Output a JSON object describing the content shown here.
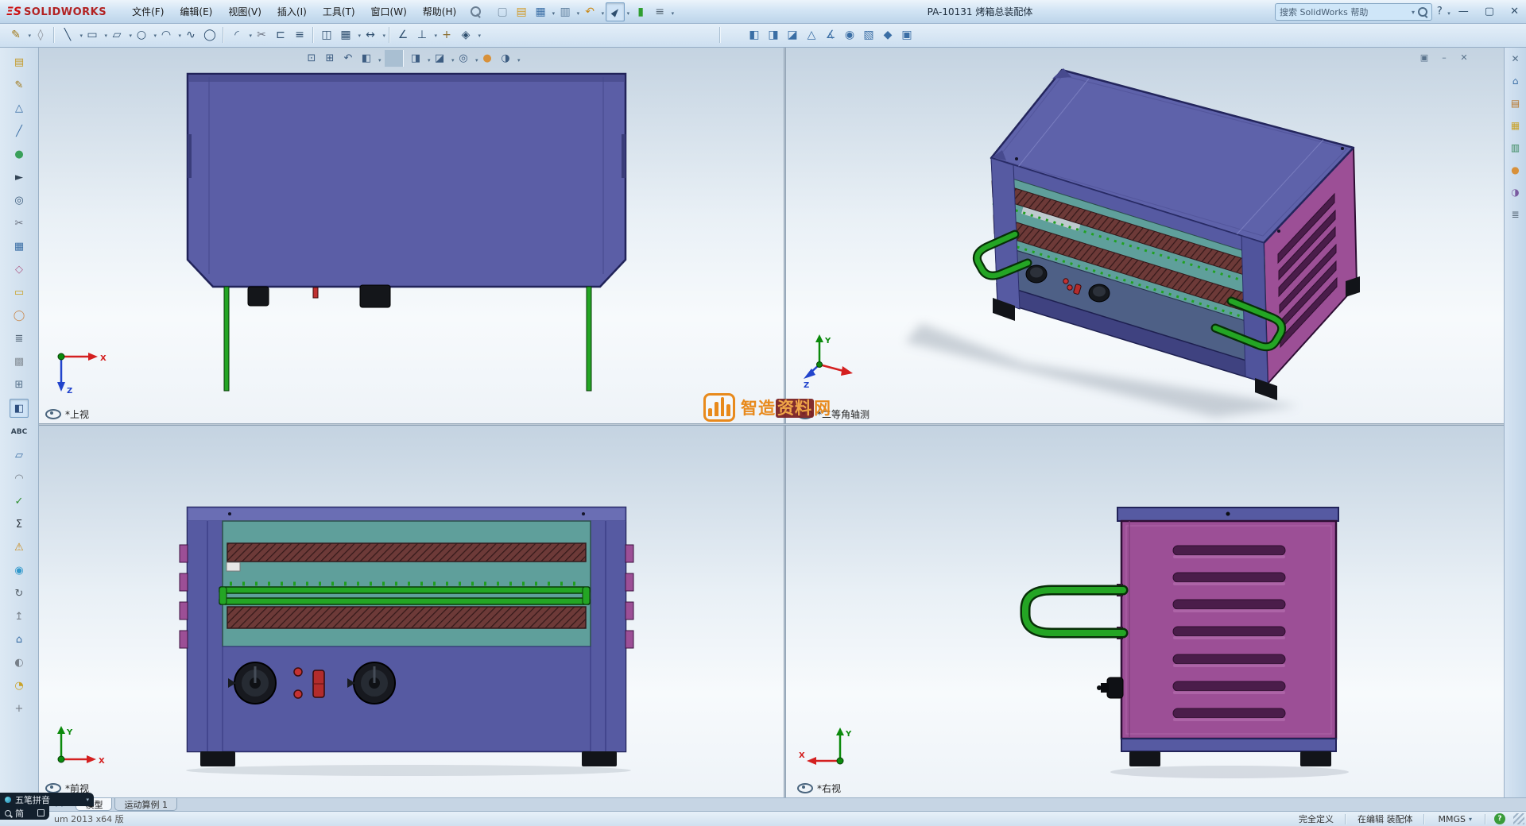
{
  "window": {
    "title": "PA-10131 烤箱总装配体"
  },
  "brand": {
    "logo_mark": "ΞS",
    "logo_text": "SOLIDWORKS"
  },
  "menubar": {
    "items": [
      {
        "name": "menu-file",
        "label": "文件(F)"
      },
      {
        "name": "menu-edit",
        "label": "编辑(E)"
      },
      {
        "name": "menu-view",
        "label": "视图(V)"
      },
      {
        "name": "menu-insert",
        "label": "插入(I)"
      },
      {
        "name": "menu-tools",
        "label": "工具(T)"
      },
      {
        "name": "menu-window",
        "label": "窗口(W)"
      },
      {
        "name": "menu-help",
        "label": "帮助(H)"
      }
    ]
  },
  "quickbar": {
    "icons": [
      {
        "name": "new-file-icon",
        "glyph": "▢",
        "color": "#8096aa"
      },
      {
        "name": "open-file-icon",
        "glyph": "▤",
        "color": "#d09a28"
      },
      {
        "name": "save-icon",
        "glyph": "▦",
        "color": "#3a6ea5",
        "dd": true
      },
      {
        "name": "print-icon",
        "glyph": "▥",
        "color": "#5b7b9a",
        "dd": true
      },
      {
        "name": "undo-icon",
        "glyph": "↶",
        "color": "#c98a1b",
        "dd": true
      },
      {
        "name": "select-icon",
        "glyph": "►",
        "color": "#2f4f6f",
        "dd": true,
        "active": true
      },
      {
        "name": "rebuild-icon",
        "glyph": "▮",
        "color": "#2f9e2f"
      },
      {
        "name": "options-icon",
        "glyph": "≡",
        "color": "#5b6b7a",
        "dd": true
      }
    ]
  },
  "search": {
    "placeholder": "搜索 SolidWorks 帮助"
  },
  "titlebar_controls": [
    {
      "name": "help-button",
      "glyph": "?",
      "dd": true
    },
    {
      "name": "minimize-button",
      "glyph": "—"
    },
    {
      "name": "maximize-button",
      "glyph": "▢"
    },
    {
      "name": "close-button",
      "glyph": "✕"
    }
  ],
  "toolbar": {
    "icons": [
      {
        "name": "sketch-icon",
        "glyph": "✎",
        "color": "#a07818",
        "dd": true
      },
      {
        "name": "eraser-icon",
        "glyph": "◊",
        "color": "#8a8f98"
      },
      {
        "sep": true
      },
      {
        "name": "line-icon",
        "glyph": "╲",
        "color": "#2f4f6f",
        "dd": true
      },
      {
        "name": "rectangle-icon",
        "glyph": "▭",
        "color": "#2f4f6f",
        "dd": true
      },
      {
        "name": "slot-icon",
        "glyph": "▱",
        "color": "#2f4f6f",
        "dd": true
      },
      {
        "name": "circle-icon",
        "glyph": "○",
        "color": "#2f4f6f",
        "dd": true
      },
      {
        "name": "arc-icon",
        "glyph": "◠",
        "color": "#2f4f6f",
        "dd": true
      },
      {
        "name": "spline-icon",
        "glyph": "∿",
        "color": "#2f4f6f"
      },
      {
        "name": "ellipse-icon",
        "glyph": "◯",
        "color": "#2f4f6f"
      },
      {
        "sep": true
      },
      {
        "name": "fillet-icon",
        "glyph": "◜",
        "color": "#2f4f6f",
        "dd": true
      },
      {
        "name": "trim-icon",
        "glyph": "✂",
        "color": "#6b7280"
      },
      {
        "name": "convert-entities-icon",
        "glyph": "⊏",
        "color": "#2f4f6f"
      },
      {
        "name": "offset-entities-icon",
        "glyph": "≡",
        "color": "#2f4f6f"
      },
      {
        "sep": true
      },
      {
        "name": "mirror-icon",
        "glyph": "◫",
        "color": "#2f4f6f"
      },
      {
        "name": "linear-pattern-icon",
        "glyph": "▦",
        "color": "#2f4f6f",
        "dd": true
      },
      {
        "name": "move-entities-icon",
        "glyph": "↔",
        "color": "#2f4f6f",
        "dd": true
      },
      {
        "sep": true
      },
      {
        "name": "smart-dimension-icon",
        "glyph": "∠",
        "color": "#2f4f6f"
      },
      {
        "name": "display-relations-icon",
        "glyph": "⊥",
        "color": "#2f4f6f",
        "dd": true
      },
      {
        "name": "repair-sketch-icon",
        "glyph": "+",
        "color": "#8a6d2f"
      },
      {
        "name": "quick-snaps-icon",
        "glyph": "◈",
        "color": "#2f4f6f",
        "dd": true
      },
      {
        "sep": true,
        "wide": true
      },
      {
        "name": "hide-show-components-icon",
        "glyph": "◧",
        "color": "#3a6ea5"
      },
      {
        "name": "change-transparency-icon",
        "glyph": "◨",
        "color": "#3a6ea5"
      },
      {
        "name": "section-view-icon",
        "glyph": "◪",
        "color": "#3a6ea5"
      },
      {
        "name": "temporary-axes-icon",
        "glyph": "△",
        "color": "#3a6ea5"
      },
      {
        "name": "measure-icon",
        "glyph": "∡",
        "color": "#3a6ea5"
      },
      {
        "name": "mass-properties-icon",
        "glyph": "◉",
        "color": "#3a6ea5"
      },
      {
        "name": "assembly-visualization-icon",
        "glyph": "▧",
        "color": "#3a6ea5"
      },
      {
        "name": "exploded-view-icon",
        "glyph": "◆",
        "color": "#3a6ea5"
      },
      {
        "name": "interference-detection-icon",
        "glyph": "▣",
        "color": "#3a6ea5"
      }
    ]
  },
  "left_toolbar": {
    "icons": [
      {
        "name": "open-document-icon",
        "glyph": "▤",
        "color": "#c49a2a"
      },
      {
        "name": "sketch-tool-icon",
        "glyph": "✎",
        "color": "#a07818"
      },
      {
        "name": "plane-icon",
        "glyph": "△",
        "color": "#3a6ea5"
      },
      {
        "name": "axis-icon",
        "glyph": "╱",
        "color": "#3a6ea5"
      },
      {
        "name": "appearance-icon",
        "glyph": "●",
        "color": "#3aa05a"
      },
      {
        "name": "select-tool-icon",
        "glyph": "►",
        "color": "#334455"
      },
      {
        "name": "zoom-icon",
        "glyph": "◎",
        "color": "#3a5a7a"
      },
      {
        "name": "cut-icon",
        "glyph": "✂",
        "color": "#6b7280"
      },
      {
        "name": "pattern-icon",
        "glyph": "▦",
        "color": "#3a6ea5"
      },
      {
        "name": "smart-fastener-icon",
        "glyph": "◇",
        "color": "#b0608a"
      },
      {
        "name": "note-icon",
        "glyph": "▭",
        "color": "#c9a227"
      },
      {
        "name": "balloon-icon",
        "glyph": "◯",
        "color": "#c98a50"
      },
      {
        "name": "bom-icon",
        "glyph": "≣",
        "color": "#556677"
      },
      {
        "name": "grid-icon",
        "glyph": "▩",
        "color": "#88919a"
      },
      {
        "name": "insert-part-icon",
        "glyph": "⊞",
        "color": "#55708a"
      },
      {
        "name": "section-view-icon",
        "glyph": "◧",
        "color": "#2f4f7f",
        "active": true
      },
      {
        "name": "spell-check-icon",
        "glyph": "ABC",
        "color": "#334455"
      },
      {
        "name": "surface-icon",
        "glyph": "▱",
        "color": "#3a6ea5"
      },
      {
        "name": "draft-icon",
        "glyph": "◠",
        "color": "#777f88"
      },
      {
        "name": "design-check-icon",
        "glyph": "✓",
        "color": "#2f8f2f"
      },
      {
        "name": "equations-icon",
        "glyph": "Σ",
        "color": "#333b44"
      },
      {
        "name": "errors-icon",
        "glyph": "⚠",
        "color": "#c98a1b"
      },
      {
        "name": "info-icon",
        "glyph": "◉",
        "color": "#3399cc"
      },
      {
        "name": "rotate-view-icon",
        "glyph": "↻",
        "color": "#555f68"
      },
      {
        "name": "export-icon",
        "glyph": "↥",
        "color": "#777f88"
      },
      {
        "name": "home-icon",
        "glyph": "⌂",
        "color": "#3a6ea5"
      },
      {
        "name": "camera-icon",
        "glyph": "◐",
        "color": "#777f88"
      },
      {
        "name": "lights-icon",
        "glyph": "◔",
        "color": "#c9a227"
      },
      {
        "name": "dof-icon",
        "glyph": "+",
        "color": "#777f88"
      }
    ]
  },
  "headsup": {
    "icons": [
      {
        "name": "zoom-fit-icon",
        "glyph": "⊡",
        "color": "#3d5d82"
      },
      {
        "name": "zoom-area-icon",
        "glyph": "⊞",
        "color": "#3d5d82"
      },
      {
        "name": "previous-view-icon",
        "glyph": "↶",
        "color": "#3d5d82"
      },
      {
        "name": "section-view-icon",
        "glyph": "◧",
        "color": "#3d5d82",
        "dd": true
      },
      {
        "sep": true
      },
      {
        "name": "view-orientation-icon",
        "glyph": "◨",
        "color": "#3d5d82",
        "dd": true
      },
      {
        "name": "display-style-icon",
        "glyph": "◪",
        "color": "#3d5d82",
        "dd": true
      },
      {
        "name": "hide-show-items-icon",
        "glyph": "◎",
        "color": "#3d5d82",
        "dd": true
      },
      {
        "name": "edit-appearance-icon",
        "glyph": "●",
        "color": "#d8913a"
      },
      {
        "name": "view-settings-icon",
        "glyph": "◑",
        "color": "#3d5d82",
        "dd": true
      }
    ]
  },
  "doc_controls": {
    "icons": [
      {
        "name": "window-tile-icon",
        "glyph": "▣"
      },
      {
        "name": "window-minimize-icon",
        "glyph": "–"
      },
      {
        "name": "window-close-icon",
        "glyph": "✕"
      }
    ]
  },
  "task_pane": {
    "icons": [
      {
        "name": "close-taskpane-icon",
        "glyph": "✕",
        "color": "#55708a"
      },
      {
        "name": "resources-home-icon",
        "glyph": "⌂",
        "color": "#3a6ea5"
      },
      {
        "name": "design-library-icon",
        "glyph": "▤",
        "color": "#b8762a"
      },
      {
        "name": "file-explorer-icon",
        "glyph": "▦",
        "color": "#c9a227"
      },
      {
        "name": "view-palette-icon",
        "glyph": "▥",
        "color": "#3a8a5f"
      },
      {
        "name": "appearances-icon",
        "glyph": "●",
        "color": "#d8913a"
      },
      {
        "name": "scenes-icon",
        "glyph": "◑",
        "color": "#7a5aa0"
      },
      {
        "name": "custom-properties-icon",
        "glyph": "≣",
        "color": "#556677"
      }
    ]
  },
  "viewports": {
    "top_left": {
      "label": "*上视"
    },
    "top_right": {
      "label": "*二等角轴测"
    },
    "bottom_left": {
      "label": "*前视"
    },
    "bottom_right": {
      "label": "*右视"
    }
  },
  "triad": {
    "x": "X",
    "y": "Y",
    "z": "Z"
  },
  "watermark": {
    "brand_left": "智造",
    "brand_mid": "资料",
    "brand_right": "网"
  },
  "tabs": {
    "nav": [
      {
        "name": "viewport-split-icon",
        "glyph": "⊞"
      },
      {
        "name": "scroll-tabs-left-icon",
        "glyph": "◂"
      },
      {
        "name": "scroll-tabs-right-icon",
        "glyph": "▸"
      }
    ],
    "items": [
      {
        "name": "tab-model",
        "label": "模型",
        "active": true
      },
      {
        "name": "tab-motion-study",
        "label": "运动算例 1"
      }
    ]
  },
  "statusbar": {
    "version_text": "um 2013 x64 版",
    "defined": "完全定义",
    "editing": "在编辑 装配体",
    "units": "MMGS",
    "help_icon": "?"
  },
  "ime": {
    "name": "五笔拼音",
    "mode": "简"
  },
  "palette": {
    "body_purple": "#5b5ea6",
    "side_magenta": "#9c4f96",
    "interior_teal": "#5f9f9b",
    "heater_maroon": "#6d3a38",
    "handle_green": "#24a524",
    "knob_black": "#15181d",
    "indicator_red": "#c43232",
    "watermark_orange": "#e8820c",
    "viewport_top": "#c4d3e1",
    "chrome_blue": "#cfe2f3"
  }
}
